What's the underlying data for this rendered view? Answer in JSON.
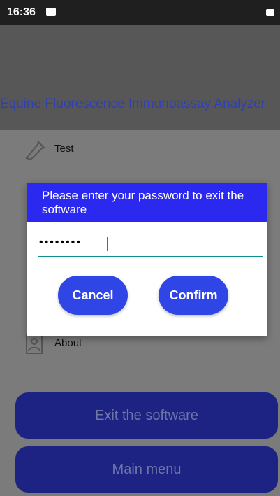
{
  "status_bar": {
    "time": "16:36"
  },
  "header": {
    "title": "Equine Fluorescence Immunoassay Analyzer"
  },
  "menu": {
    "items": [
      {
        "label": "Test",
        "icon": "test-tube-icon"
      },
      {
        "label": "About",
        "icon": "user-card-icon"
      }
    ]
  },
  "dialog": {
    "title": "Please enter your password to exit the software",
    "password_mask": "••••••••",
    "cancel_label": "Cancel",
    "confirm_label": "Confirm"
  },
  "buttons": {
    "exit_label": "Exit the software",
    "main_menu_label": "Main menu"
  }
}
